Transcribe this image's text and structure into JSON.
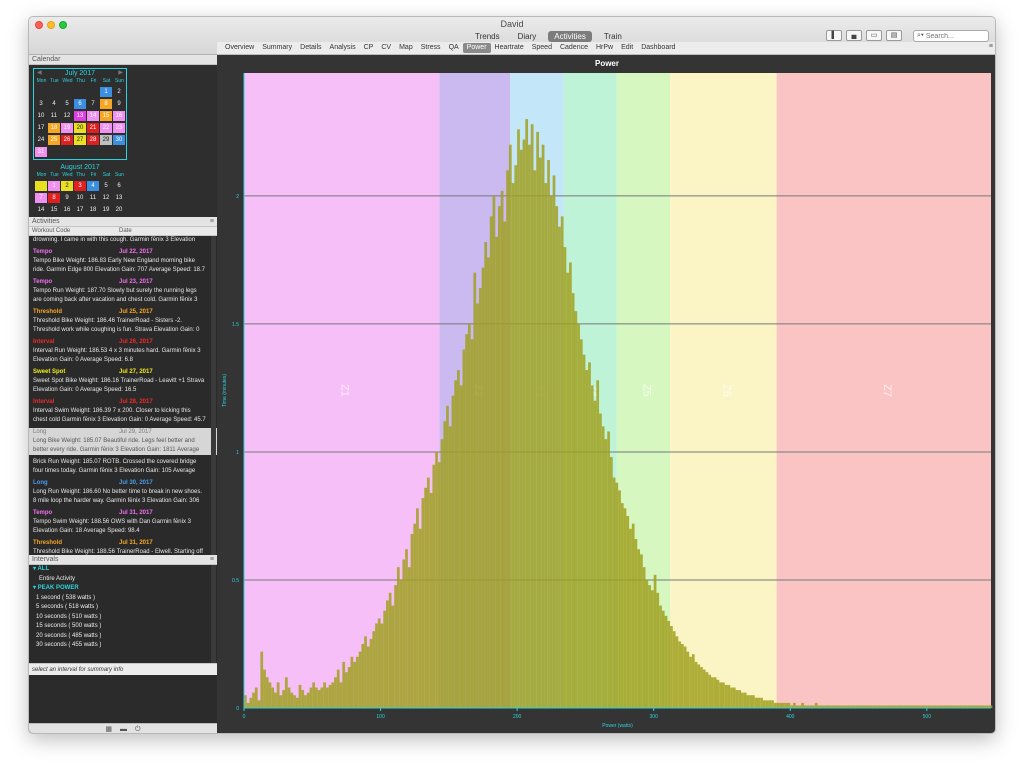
{
  "window": {
    "title": "David",
    "views": [
      {
        "label": "Trends",
        "active": false
      },
      {
        "label": "Diary",
        "active": false
      },
      {
        "label": "Activities",
        "active": true
      },
      {
        "label": "Train",
        "active": false
      }
    ],
    "search_placeholder": "Search..."
  },
  "tabs": [
    "Overview",
    "Summary",
    "Details",
    "Analysis",
    "CP",
    "CV",
    "Map",
    "Stress",
    "QA",
    "Power",
    "Heartrate",
    "Speed",
    "Cadence",
    "HrPw",
    "Edit",
    "Dashboard"
  ],
  "active_tab": "Power",
  "sidebar": {
    "calendar_header": "Calendar",
    "activities_header": "Activities",
    "col_workout_code": "Workout Code",
    "col_date": "Date",
    "intervals_header": "Intervals",
    "interval_hint": "select an interval for summary info",
    "calendars": [
      {
        "title": "July 2017",
        "dow": [
          "Mon",
          "Tue",
          "Wed",
          "Thu",
          "Fri",
          "Sat",
          "Sun"
        ],
        "offset": 5,
        "days": [
          {
            "n": "1",
            "c": "#3b8fe0"
          },
          {
            "n": "2",
            "c": ""
          },
          {
            "n": "3",
            "c": ""
          },
          {
            "n": "4",
            "c": ""
          },
          {
            "n": "5",
            "c": ""
          },
          {
            "n": "6",
            "c": "#3b8fe0"
          },
          {
            "n": "7",
            "c": ""
          },
          {
            "n": "8",
            "c": "#f5a623"
          },
          {
            "n": "9",
            "c": ""
          },
          {
            "n": "10",
            "c": ""
          },
          {
            "n": "11",
            "c": ""
          },
          {
            "n": "12",
            "c": ""
          },
          {
            "n": "13",
            "c": "#e040e0"
          },
          {
            "n": "14",
            "c": "#f090f0"
          },
          {
            "n": "15",
            "c": "#f5a623"
          },
          {
            "n": "16",
            "c": "#f090f0"
          },
          {
            "n": "17",
            "c": ""
          },
          {
            "n": "18",
            "c": "#f5a623"
          },
          {
            "n": "19",
            "c": "#f090f0"
          },
          {
            "n": "20",
            "c": "#e8e020"
          },
          {
            "n": "21",
            "c": "#e02020"
          },
          {
            "n": "22",
            "c": "#f090f0"
          },
          {
            "n": "23",
            "c": "#f090f0"
          },
          {
            "n": "24",
            "c": ""
          },
          {
            "n": "25",
            "c": "#f5a623"
          },
          {
            "n": "26",
            "c": "#e02020"
          },
          {
            "n": "27",
            "c": "#e8e020"
          },
          {
            "n": "28",
            "c": "#e02020"
          },
          {
            "n": "29",
            "c": "#c0c0c0"
          },
          {
            "n": "30",
            "c": "#3b8fe0"
          },
          {
            "n": "31",
            "c": "#f090f0"
          }
        ]
      },
      {
        "title": "August 2017",
        "dow": [
          "Mon",
          "Tue",
          "Wed",
          "Thu",
          "Fri",
          "Sat",
          "Sun"
        ],
        "offset": 0,
        "days": [
          {
            "n": "",
            "c": "#e8e020"
          },
          {
            "n": "1",
            "c": "#f090f0"
          },
          {
            "n": "2",
            "c": "#e8e020"
          },
          {
            "n": "3",
            "c": "#e02020"
          },
          {
            "n": "4",
            "c": "#3b8fe0"
          },
          {
            "n": "5",
            "c": ""
          },
          {
            "n": "6",
            "c": ""
          },
          {
            "n": "7",
            "c": "#f090f0"
          },
          {
            "n": "8",
            "c": "#e02020"
          },
          {
            "n": "9",
            "c": ""
          },
          {
            "n": "10",
            "c": ""
          },
          {
            "n": "11",
            "c": ""
          },
          {
            "n": "12",
            "c": ""
          },
          {
            "n": "13",
            "c": ""
          },
          {
            "n": "14",
            "c": ""
          },
          {
            "n": "15",
            "c": ""
          },
          {
            "n": "16",
            "c": ""
          },
          {
            "n": "17",
            "c": ""
          },
          {
            "n": "18",
            "c": ""
          },
          {
            "n": "19",
            "c": ""
          },
          {
            "n": "20",
            "c": ""
          }
        ]
      }
    ],
    "activities": [
      {
        "type": "",
        "date": "",
        "color": "#ffffff",
        "desc": [
          "drowning. I came in with this cough. Garmin fēnix 3 Elevation"
        ]
      },
      {
        "type": "Tempo",
        "date": "Jul 22, 2017",
        "color": "#f16ef1",
        "desc": [
          "Tempo Bike Weight: 186.83 Early New England morning bike",
          "ride. Garmin Edge 800 Elevation Gain: 707 Average Speed: 18.7"
        ]
      },
      {
        "type": "Tempo",
        "date": "Jul 23, 2017",
        "color": "#f16ef1",
        "desc": [
          "Tempo Run Weight: 187.70 Slowly but surely the running legs",
          "are coming back after vacation and chest cold. Garmin fēnix 3"
        ]
      },
      {
        "type": "Threshold",
        "date": "Jul 25, 2017",
        "color": "#f5a623",
        "desc": [
          "Threshold Bike Weight: 186.46 TrainerRoad - Sisters -2.",
          "Threshold work while coughing is fun. Strava Elevation Gain: 0"
        ]
      },
      {
        "type": "Interval",
        "date": "Jul 26, 2017",
        "color": "#ee2a2a",
        "desc": [
          "Interval Run Weight: 186.53 4 x 3 minutes hard. Garmin fēnix 3",
          "Elevation Gain: 0 Average Speed: 6.8"
        ]
      },
      {
        "type": "Sweet Spot",
        "date": "Jul 27, 2017",
        "color": "#f2ea1c",
        "desc": [
          "Sweet Spot Bike Weight: 186.16 TrainerRoad - Leavitt +1 Strava",
          "Elevation Gain: 0 Average Speed: 16.5"
        ]
      },
      {
        "type": "Interval",
        "date": "Jul 28, 2017",
        "color": "#ee2a2a",
        "desc": [
          "Interval Swim Weight: 186.39 7 x 200. Closer to kicking this",
          "chest cold Garmin fēnix 3 Elevation Gain: 0 Average Speed: 45.7"
        ]
      },
      {
        "type": "Long",
        "date": "Jul 29, 2017",
        "color": "#777777",
        "selected": true,
        "desc": [
          "Long Bike Weight: 185.07 Beautiful ride. Legs feel better and",
          "better every ride. Garmin fēnix 3 Elevation Gain: 1811 Average"
        ]
      },
      {
        "type": "",
        "date": "",
        "color": "#ffffff",
        "desc": [
          "Brick Run Weight: 185.07 ROTB. Crossed the covered bridge",
          "four times today. Garmin fēnix 3 Elevation Gain: 105 Average"
        ]
      },
      {
        "type": "Long",
        "date": "Jul 30, 2017",
        "color": "#4a9cf0",
        "desc": [
          "Long Run Weight: 186.60 No better time to break in new shoes.",
          "8 mile loop the harder way. Garmin fēnix 3 Elevation Gain: 306"
        ]
      },
      {
        "type": "Tempo",
        "date": "Jul 31, 2017",
        "color": "#f16ef1",
        "desc": [
          "Tempo Swim Weight: 188.56 OWS with Dan Garmin fēnix 3",
          "Elevation Gain: 18 Average Speed: 98.4"
        ]
      },
      {
        "type": "Threshold",
        "date": "Jul 31, 2017",
        "color": "#f5a623",
        "desc": [
          "Threshold Bike Weight: 188.56 TrainerRoad - Elwell. Starting off",
          "peak volume week with tired legs. Strava Elevation Gain: 0"
        ]
      }
    ],
    "intervals": [
      {
        "label": "▾ ALL",
        "group": true
      },
      {
        "label": "Entire Activity",
        "group": false,
        "indent": 2
      },
      {
        "label": "▾ PEAK POWER",
        "group": true
      },
      {
        "label": "1 second ( 538 watts )",
        "group": false,
        "indent": 1
      },
      {
        "label": "5 seconds ( 518 watts )",
        "group": false,
        "indent": 1
      },
      {
        "label": "10 seconds ( 510 watts )",
        "group": false,
        "indent": 1
      },
      {
        "label": "15 seconds ( 500 watts )",
        "group": false,
        "indent": 1
      },
      {
        "label": "20 seconds ( 485 watts )",
        "group": false,
        "indent": 1
      },
      {
        "label": "30 seconds ( 455 watts )",
        "group": false,
        "indent": 1
      }
    ]
  },
  "chart_data": {
    "type": "bar",
    "title": "Power",
    "xlabel": "Power (watts)",
    "ylabel": "Time (minutes)",
    "xlim": [
      0,
      547
    ],
    "ylim": [
      0,
      2.48
    ],
    "xticks": [
      "0",
      "100",
      "200",
      "300",
      "400",
      "500"
    ],
    "xtick_values": [
      0,
      100,
      200,
      300,
      400,
      500
    ],
    "yticks": [
      "0",
      "0.5",
      "1",
      "1.5",
      "2"
    ],
    "ytick_values": [
      0,
      0.5,
      1,
      1.5,
      2
    ],
    "grid": true,
    "bar_color": "#a0a020",
    "zones": [
      {
        "label": "Z1",
        "from": 0,
        "to": 143,
        "color": "#f7bff7"
      },
      {
        "label": "Z2",
        "from": 143,
        "to": 195,
        "color": "#cbbaf0"
      },
      {
        "label": "Z3",
        "from": 195,
        "to": 234,
        "color": "#c3e6f8"
      },
      {
        "label": "Z4",
        "from": 234,
        "to": 273,
        "color": "#bff3d8"
      },
      {
        "label": "Z5",
        "from": 273,
        "to": 312,
        "color": "#d6f8c0"
      },
      {
        "label": "Z6",
        "from": 312,
        "to": 390,
        "color": "#fbf4c4"
      },
      {
        "label": "Z7",
        "from": 390,
        "to": 547,
        "color": "#fbc4c4"
      }
    ],
    "bin_start": 0,
    "bin_width": 2,
    "values": [
      0.05,
      0.02,
      0.04,
      0.06,
      0.08,
      0.03,
      0.22,
      0.15,
      0.12,
      0.1,
      0.08,
      0.06,
      0.1,
      0.05,
      0.07,
      0.12,
      0.08,
      0.06,
      0.05,
      0.04,
      0.09,
      0.07,
      0.05,
      0.06,
      0.08,
      0.1,
      0.08,
      0.07,
      0.08,
      0.1,
      0.08,
      0.09,
      0.1,
      0.12,
      0.15,
      0.1,
      0.18,
      0.14,
      0.16,
      0.2,
      0.18,
      0.2,
      0.22,
      0.25,
      0.28,
      0.24,
      0.27,
      0.3,
      0.33,
      0.35,
      0.33,
      0.38,
      0.42,
      0.45,
      0.4,
      0.48,
      0.55,
      0.5,
      0.58,
      0.62,
      0.55,
      0.68,
      0.72,
      0.78,
      0.7,
      0.82,
      0.86,
      0.9,
      0.84,
      0.95,
      1.0,
      0.96,
      1.05,
      1.12,
      1.18,
      1.1,
      1.22,
      1.28,
      1.32,
      1.26,
      1.4,
      1.46,
      1.5,
      1.44,
      1.7,
      1.58,
      1.64,
      1.72,
      1.82,
      1.76,
      1.92,
      2.0,
      1.84,
      1.96,
      2.02,
      1.9,
      2.1,
      2.2,
      2.05,
      2.12,
      2.26,
      2.18,
      2.22,
      2.3,
      2.2,
      2.28,
      2.1,
      2.25,
      2.15,
      2.2,
      2.05,
      2.14,
      2.0,
      2.08,
      1.96,
      1.88,
      1.92,
      1.8,
      1.7,
      1.74,
      1.62,
      1.55,
      1.5,
      1.44,
      1.38,
      1.32,
      1.35,
      1.26,
      1.2,
      1.28,
      1.15,
      1.1,
      1.05,
      1.08,
      0.98,
      0.9,
      0.88,
      0.85,
      0.8,
      0.78,
      0.75,
      0.7,
      0.72,
      0.66,
      0.62,
      0.6,
      0.55,
      0.5,
      0.48,
      0.46,
      0.52,
      0.45,
      0.4,
      0.38,
      0.36,
      0.34,
      0.32,
      0.3,
      0.28,
      0.26,
      0.25,
      0.24,
      0.22,
      0.2,
      0.21,
      0.18,
      0.17,
      0.16,
      0.15,
      0.14,
      0.13,
      0.12,
      0.12,
      0.11,
      0.1,
      0.1,
      0.09,
      0.09,
      0.08,
      0.08,
      0.07,
      0.07,
      0.06,
      0.06,
      0.05,
      0.05,
      0.05,
      0.04,
      0.04,
      0.04,
      0.03,
      0.03,
      0.03,
      0.03,
      0.02,
      0.02,
      0.02,
      0.02,
      0.02,
      0.02,
      0.01,
      0.02,
      0.01,
      0.01,
      0.02,
      0.01,
      0.01,
      0.01,
      0.01,
      0.02,
      0.01,
      0.01,
      0.01,
      0.01,
      0.01,
      0.01,
      0.01,
      0.01,
      0.01,
      0.01,
      0.01,
      0.01,
      0.01,
      0.01,
      0.01,
      0.01,
      0.01,
      0.01,
      0.01,
      0.01,
      0.01,
      0.01,
      0.01,
      0.01,
      0.01,
      0.01,
      0.01,
      0.01,
      0.01,
      0.01,
      0.01,
      0.01,
      0.01,
      0.01,
      0.01,
      0.01,
      0.01,
      0.01,
      0.01,
      0.01,
      0.01,
      0.01,
      0.01,
      0.01,
      0.01,
      0.01,
      0.01,
      0.01,
      0.01,
      0.01,
      0.01,
      0.01,
      0.01,
      0.01,
      0.01,
      0.01,
      0.01,
      0.01,
      0.01,
      0.01,
      0.01,
      0.01,
      0.01,
      0.01,
      0.01,
      0.01
    ]
  }
}
